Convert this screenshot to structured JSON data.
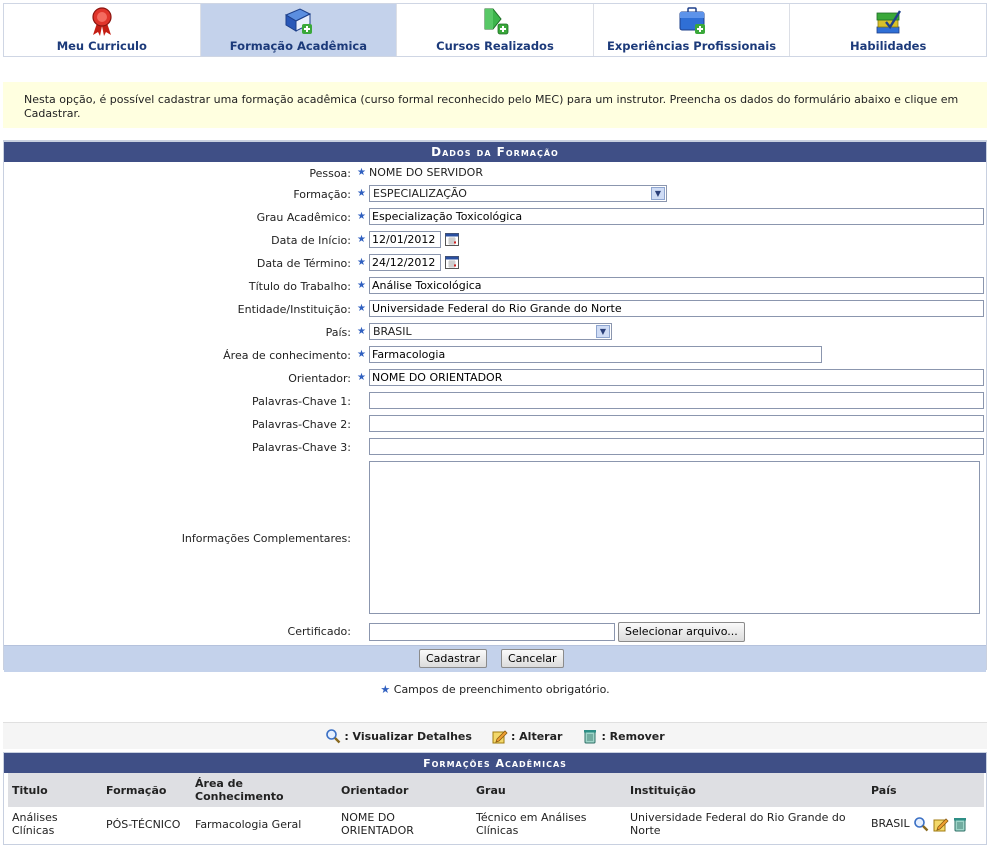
{
  "tabs": [
    {
      "label": "Meu Curriculo",
      "icon": "ribbon-award-icon"
    },
    {
      "label": "Formação Acadêmica",
      "icon": "book-add-icon",
      "active": true
    },
    {
      "label": "Cursos Realizados",
      "icon": "certificate-add-icon"
    },
    {
      "label": "Experiências Profissionais",
      "icon": "briefcase-add-icon"
    },
    {
      "label": "Habilidades",
      "icon": "books-check-icon"
    }
  ],
  "info_text": "Nesta opção, é possível cadastrar uma formação acadêmica (curso formal reconhecido pelo MEC) para um instrutor. Preencha os dados do formulário abaixo e clique em Cadastrar.",
  "form": {
    "caption": "Dados da Formação",
    "pessoa_label": "Pessoa:",
    "pessoa_value": "NOME DO SERVIDOR",
    "formacao_label": "Formação:",
    "formacao_value": "ESPECIALIZAÇÃO",
    "grau_label": "Grau Acadêmico:",
    "grau_value": "Especialização Toxicológica",
    "inicio_label": "Data de Início:",
    "inicio_value": "12/01/2012",
    "termino_label": "Data de Término:",
    "termino_value": "24/12/2012",
    "titulo_label": "Título do Trabalho:",
    "titulo_value": "Análise Toxicológica",
    "entidade_label": "Entidade/Instituição:",
    "entidade_value": "Universidade Federal do Rio Grande do Norte",
    "pais_label": "País:",
    "pais_value": "BRASIL",
    "area_label": "Área de conhecimento:",
    "area_value": "Farmacologia",
    "orientador_label": "Orientador:",
    "orientador_value": "NOME DO ORIENTADOR",
    "kw1_label": "Palavras-Chave 1:",
    "kw1_value": "",
    "kw2_label": "Palavras-Chave 2:",
    "kw2_value": "",
    "kw3_label": "Palavras-Chave 3:",
    "kw3_value": "",
    "info_label": "Informações Complementares:",
    "info_value": "",
    "cert_label": "Certificado:",
    "cert_value": "",
    "select_file": "Selecionar arquivo...",
    "submit": "Cadastrar",
    "cancel": "Cancelar",
    "required_star": "★"
  },
  "required_note": "Campos de preenchimento obrigatório.",
  "legend": [
    {
      "icon": "magnifier-icon",
      "label": ": Visualizar Detalhes"
    },
    {
      "icon": "edit-icon",
      "label": ": Alterar"
    },
    {
      "icon": "trash-icon",
      "label": ": Remover"
    }
  ],
  "table": {
    "caption": "Formações Acadêmicas",
    "headers": [
      "Titulo",
      "Formação",
      "Área de Conhecimento",
      "Orientador",
      "Grau",
      "Instituição",
      "País"
    ],
    "rows": [
      [
        "Análises Clínicas",
        "PÓS-TÉCNICO",
        "Farmacologia Geral",
        "NOME DO ORIENTADOR",
        "Técnico em Análises Clínicas",
        "Universidade Federal do Rio Grande do Norte",
        "BRASIL"
      ]
    ]
  },
  "colors": {
    "caption_bg": "#3f4f86",
    "tab_active": "#c4d2eb",
    "info_bg": "#ffffe0",
    "star": "#3060c0"
  }
}
